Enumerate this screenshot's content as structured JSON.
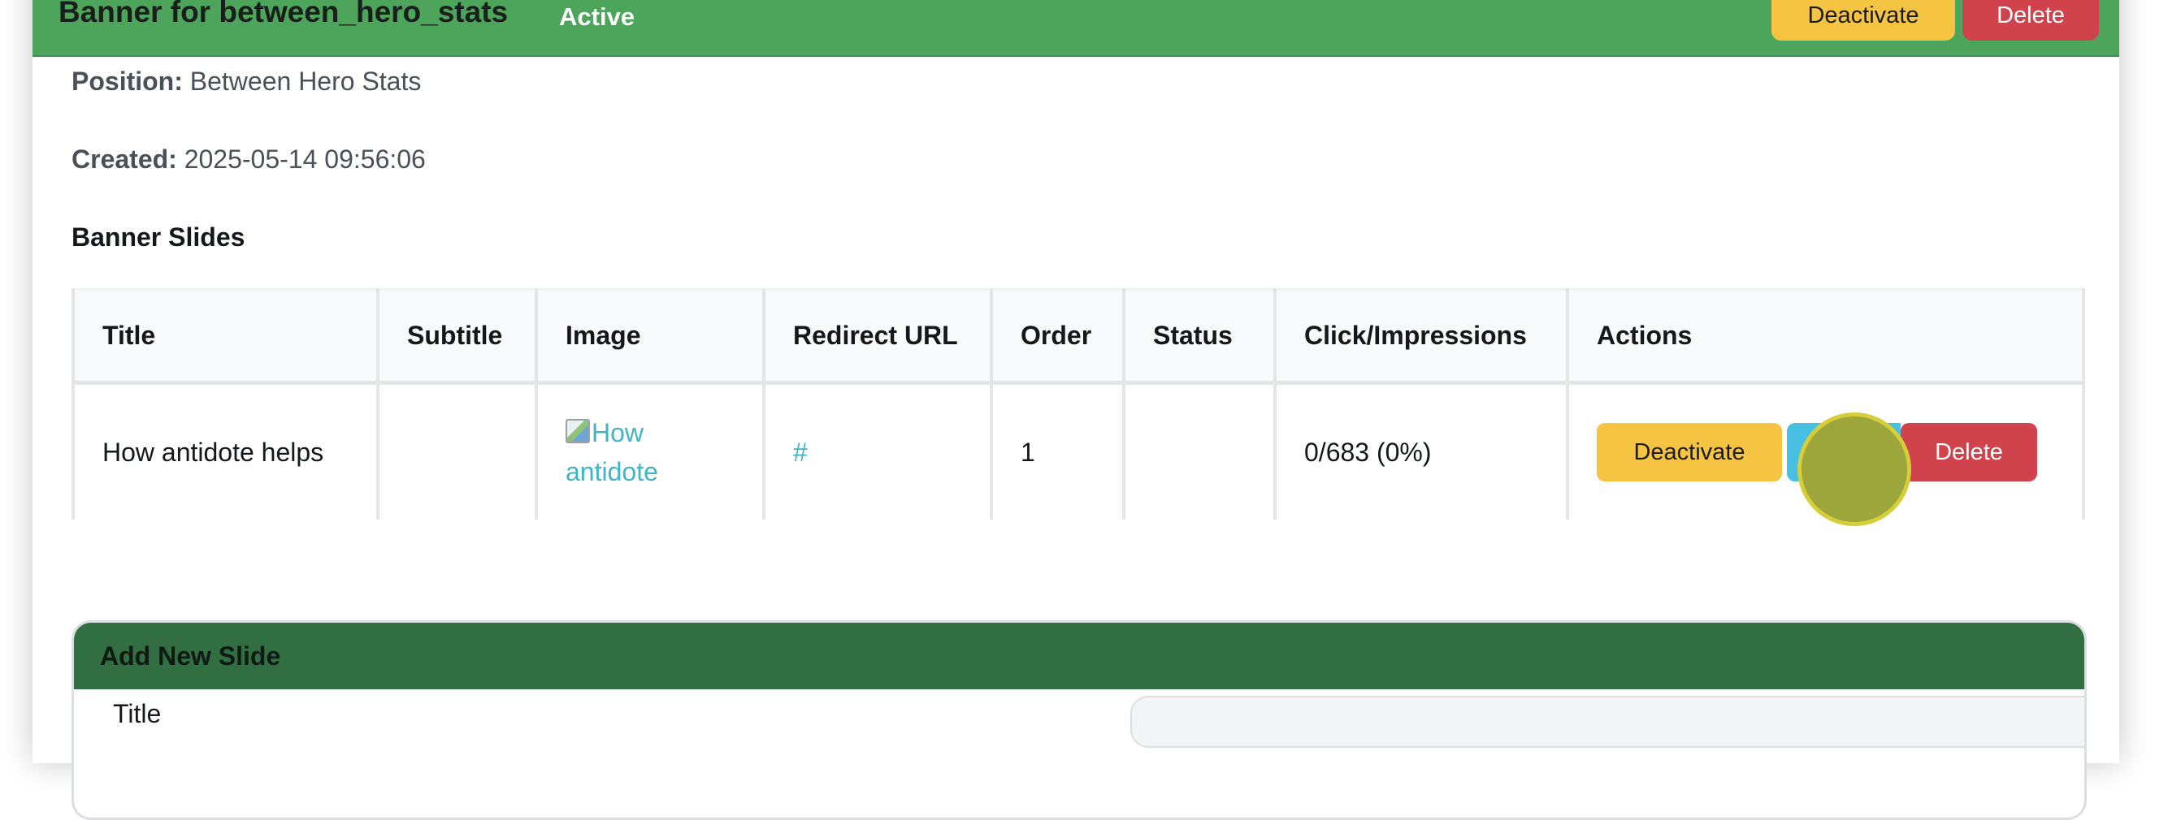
{
  "banner": {
    "title": "Banner for between_hero_stats",
    "status": "Active",
    "deactivate_label": "Deactivate",
    "delete_label": "Delete",
    "position_label": "Position:",
    "position_value": "Between Hero Stats",
    "created_label": "Created:",
    "created_value": "2025-05-14 09:56:06"
  },
  "slides": {
    "section_title": "Banner Slides",
    "columns": [
      "Title",
      "Subtitle",
      "Image",
      "Redirect URL",
      "Order",
      "Status",
      "Click/Impressions",
      "Actions"
    ],
    "rows": [
      {
        "title": "How antidote helps",
        "subtitle": "",
        "image_alt": "How antidote",
        "redirect_url": "#",
        "order": "1",
        "status": "",
        "click_impressions": "0/683 (0%)",
        "deactivate_label": "Deactivate",
        "edit_label": "Edit",
        "delete_label": "Delete"
      }
    ]
  },
  "add_slide": {
    "header": "Add New Slide",
    "title_label": "Title"
  },
  "colors": {
    "header_green": "#4ca55a",
    "dark_green": "#316f42",
    "warning_yellow": "#f6c443",
    "danger_red": "#d0434d",
    "info_cyan": "#47bfe3",
    "link_cyan": "#3fb6c6"
  }
}
